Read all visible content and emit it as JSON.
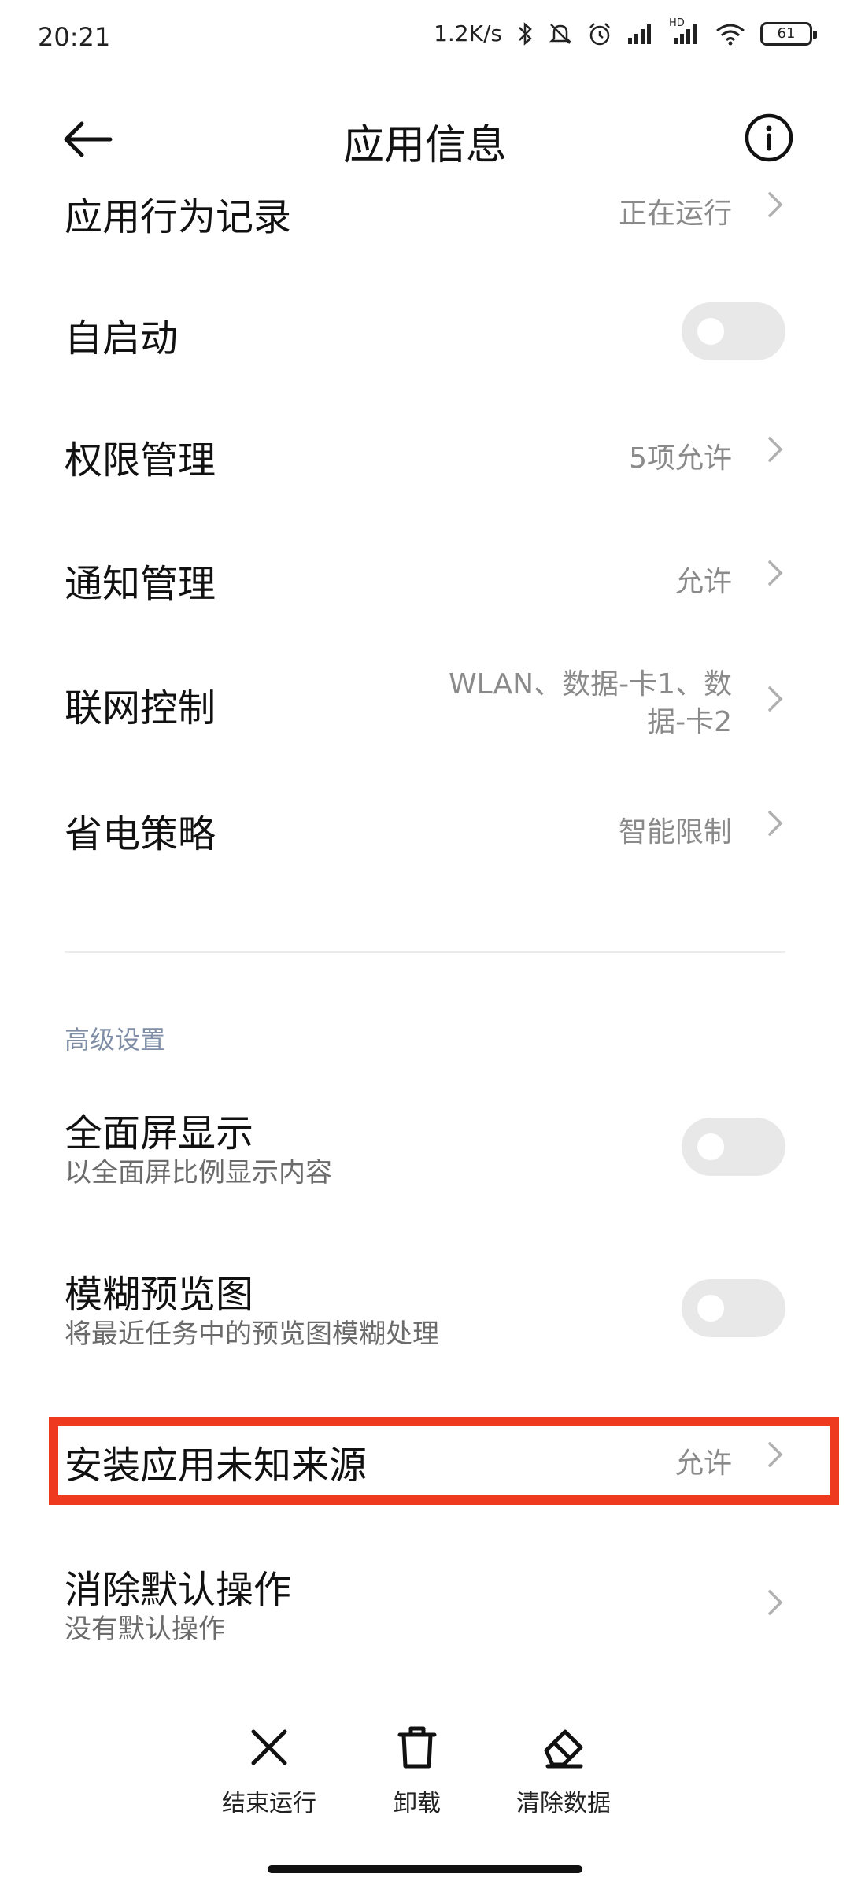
{
  "status_bar": {
    "time": "20:21",
    "network_speed": "1.2K/s",
    "hd_label": "HD",
    "battery": "61",
    "icons": [
      "bluetooth-icon",
      "mute-icon",
      "alarm-icon",
      "signal-icon",
      "signal-hd-icon",
      "wifi-icon",
      "battery-icon"
    ]
  },
  "header": {
    "title": "应用信息",
    "back_icon": "back-arrow-icon",
    "info_icon": "info-icon"
  },
  "rows": {
    "behavior": {
      "title": "应用行为记录",
      "value": "正在运行"
    },
    "autostart": {
      "title": "自启动",
      "toggle_on": false
    },
    "permissions": {
      "title": "权限管理",
      "value": "5项允许"
    },
    "notifications": {
      "title": "通知管理",
      "value": "允许"
    },
    "network": {
      "title": "联网控制",
      "value_line1": "WLAN、数据-卡1、数",
      "value_line2": "据-卡2"
    },
    "battery_saver": {
      "title": "省电策略",
      "value": "智能限制"
    }
  },
  "advanced": {
    "section_title": "高级设置",
    "fullscreen": {
      "title": "全面屏显示",
      "subtitle": "以全面屏比例显示内容",
      "toggle_on": false
    },
    "blur_preview": {
      "title": "模糊预览图",
      "subtitle": "将最近任务中的预览图模糊处理",
      "toggle_on": false
    },
    "unknown_sources": {
      "title": "安装应用未知来源",
      "value": "允许",
      "highlighted": true,
      "highlight_color": "#ee3a1f"
    },
    "clear_defaults": {
      "title": "消除默认操作",
      "subtitle": "没有默认操作"
    }
  },
  "bottom_actions": {
    "force_stop": {
      "label": "结束运行",
      "icon": "close-x-icon"
    },
    "uninstall": {
      "label": "卸载",
      "icon": "trash-icon"
    },
    "clear_data": {
      "label": "清除数据",
      "icon": "eraser-icon"
    }
  }
}
